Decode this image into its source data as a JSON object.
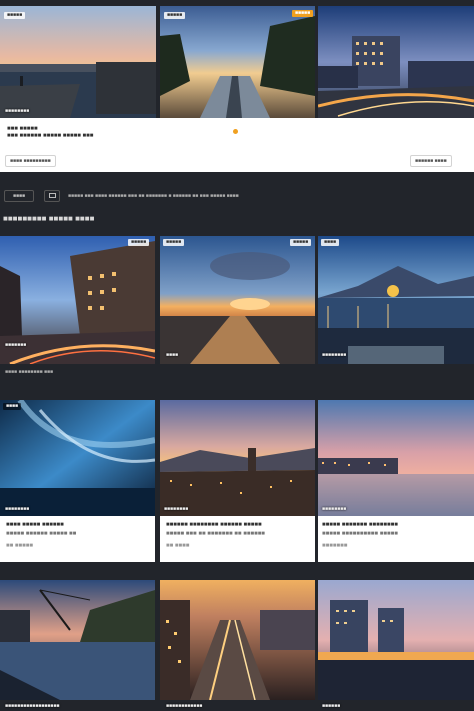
{
  "featured": {
    "badges": [
      "■■■■■",
      "■■■■■",
      "■■■■■"
    ],
    "caption": "■■■■■■■■",
    "title_line1": "■■■ ■■■■■",
    "title_line2": "■■■ ■■■■■■ ■■■■■ ■■■■■ ■■■",
    "meta_left": "■■■■ ■■■■■■■■■",
    "meta_right": "■■■■■■ ■■■■"
  },
  "toolbar": {
    "button1_label": "■■■■",
    "filter_text": "■■■■■ ■■■ ■■■■ ■■■■■■ ■■■ ■■ ■■■■■■■ ■ ■■■■■■ ■■ ■■■ ■■■■■ ■■■■"
  },
  "section": {
    "title": "■■■■■■■■■ ■■■■■ ■■■■"
  },
  "row1": {
    "badges": [
      "■■■■■",
      "■■■■■",
      "■■■■■",
      "■■■■"
    ],
    "captions": [
      "■■■■■■■",
      "■■■■",
      "■■■■■■■■"
    ],
    "footer_text": "■■■■ ■■■■■■■■ ■■■"
  },
  "row2": {
    "badges": [
      "■■■■"
    ],
    "captions": [
      "■■■■■■■■",
      "■■■■■■■■",
      "■■■■■■■■"
    ],
    "cards": [
      {
        "line1": "■■■■ ■■■■■ ■■■■■■",
        "line2": "■■■■■ ■■■■■■ ■■■■■ ■■",
        "line3": "■■ ■■■■■"
      },
      {
        "line1": "■■■■■■ ■■■■■■■■ ■■■■■■ ■■■■■",
        "line2": "■■■■■ ■■■ ■■ ■■■■■■■ ■■ ■■■■■■",
        "line3": "■■ ■■■■"
      },
      {
        "line1": "■■■■■ ■■■■■■■ ■■■■■■■■",
        "line2": "■■■■■ ■■■■■■■■■■ ■■■■■",
        "line3": "■■■■■■■"
      }
    ]
  },
  "row3": {
    "captions": [
      "■■■■■■■■■■■■■■■■■■",
      "■■■■■■■■■■■■",
      "■■■■■■"
    ]
  },
  "colors": {
    "background": "#22252b",
    "accent": "#f0a020"
  }
}
